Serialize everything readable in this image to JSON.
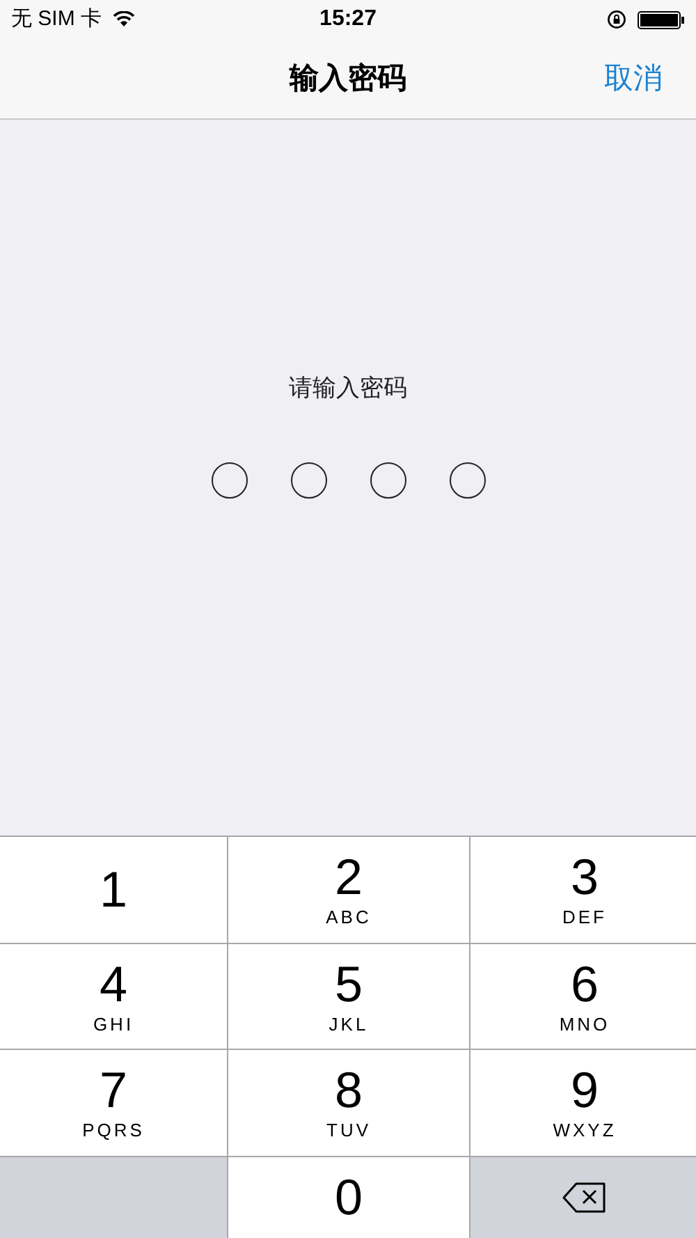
{
  "status_bar": {
    "carrier": "无 SIM 卡",
    "time": "15:27"
  },
  "nav": {
    "title": "输入密码",
    "cancel": "取消"
  },
  "prompt": "请输入密码",
  "passcode_dots": [
    {
      "filled": false
    },
    {
      "filled": false
    },
    {
      "filled": false
    },
    {
      "filled": false
    }
  ],
  "keypad": [
    {
      "kind": "digit",
      "digit": "1"
    },
    {
      "kind": "digit",
      "digit": "2",
      "letters": "ABC"
    },
    {
      "kind": "digit",
      "digit": "3",
      "letters": "DEF"
    },
    {
      "kind": "digit",
      "digit": "4",
      "letters": "GHI"
    },
    {
      "kind": "digit",
      "digit": "5",
      "letters": "JKL"
    },
    {
      "kind": "digit",
      "digit": "6",
      "letters": "MNO"
    },
    {
      "kind": "digit",
      "digit": "7",
      "letters": "PQRS"
    },
    {
      "kind": "digit",
      "digit": "8",
      "letters": "TUV"
    },
    {
      "kind": "digit",
      "digit": "9",
      "letters": "WXYZ"
    },
    {
      "kind": "blank"
    },
    {
      "kind": "digit",
      "digit": "0"
    },
    {
      "kind": "delete"
    }
  ]
}
